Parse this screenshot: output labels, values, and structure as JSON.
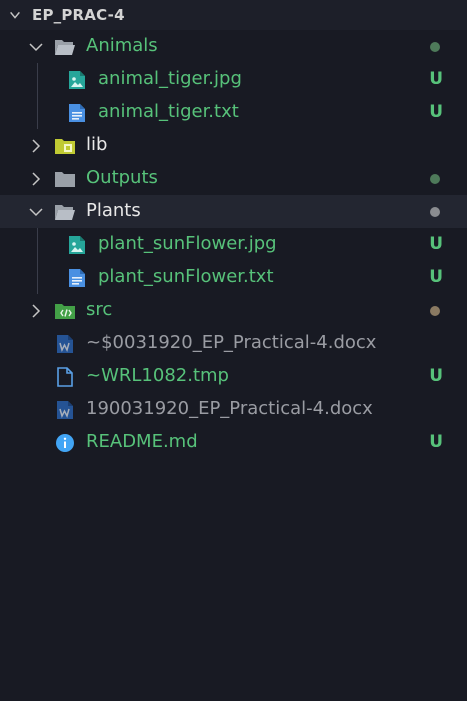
{
  "explorer": {
    "title": "EP_PRAC-4",
    "items": [
      {
        "label": "Animals",
        "status": "",
        "dot_color": "#4e7a5a"
      },
      {
        "label": "animal_tiger.jpg",
        "status": "U"
      },
      {
        "label": "animal_tiger.txt",
        "status": "U"
      },
      {
        "label": "lib",
        "status": ""
      },
      {
        "label": "Outputs",
        "status": "",
        "dot_color": "#4e7a5a"
      },
      {
        "label": "Plants",
        "status": "",
        "dot_color": "#8a8c90"
      },
      {
        "label": "plant_sunFlower.jpg",
        "status": "U"
      },
      {
        "label": "plant_sunFlower.txt",
        "status": "U"
      },
      {
        "label": "src",
        "status": "",
        "dot_color": "#8a7a62"
      },
      {
        "label": "~$0031920_EP_Practical-4.docx",
        "status": ""
      },
      {
        "label": "~WRL1082.tmp",
        "status": "U"
      },
      {
        "label": "190031920_EP_Practical-4.docx",
        "status": ""
      },
      {
        "label": "README.md",
        "status": "U"
      }
    ]
  },
  "colors": {
    "background": "#181a23",
    "untracked_green": "#57c27a",
    "selected_row": "#232631",
    "ignored_grey": "#9a9ca3"
  }
}
